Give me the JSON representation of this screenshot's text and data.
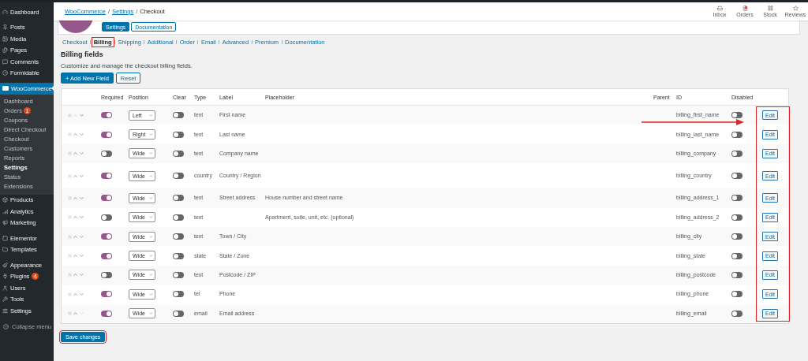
{
  "sidebar": {
    "sections": [
      [
        {
          "label": "Dashboard",
          "selected": false
        }
      ],
      [
        {
          "label": "Posts",
          "selected": false
        },
        {
          "label": "Media",
          "selected": false
        },
        {
          "label": "Pages",
          "selected": false
        },
        {
          "label": "Comments",
          "selected": false
        },
        {
          "label": "Formidable",
          "selected": false
        }
      ],
      [
        {
          "label": "WooCommerce",
          "selected": true,
          "children": [
            {
              "label": "Dashboard",
              "selected": false
            },
            {
              "label": "Orders",
              "badge": "1",
              "selected": false
            },
            {
              "label": "Coupons",
              "selected": false
            },
            {
              "label": "Direct Checkout",
              "selected": false
            },
            {
              "label": "Checkout",
              "selected": false
            },
            {
              "label": "Customers",
              "selected": false
            },
            {
              "label": "Reports",
              "selected": false
            },
            {
              "label": "Settings",
              "selected": true
            },
            {
              "label": "Status",
              "selected": false
            },
            {
              "label": "Extensions",
              "selected": false
            }
          ]
        },
        {
          "label": "Products",
          "selected": false
        },
        {
          "label": "Analytics",
          "selected": false
        },
        {
          "label": "Marketing",
          "selected": false
        }
      ],
      [
        {
          "label": "Elementor",
          "selected": false
        },
        {
          "label": "Templates",
          "selected": false
        }
      ],
      [
        {
          "label": "Appearance",
          "selected": false
        },
        {
          "label": "Plugins",
          "badge": "4",
          "selected": false
        },
        {
          "label": "Users",
          "selected": false
        },
        {
          "label": "Tools",
          "selected": false
        },
        {
          "label": "Settings",
          "selected": false
        }
      ]
    ],
    "collapse": "Collapse menu"
  },
  "breadcrumb": {
    "separator": "/",
    "items": [
      {
        "label": "WooCommerce",
        "link": true
      },
      {
        "label": "Settings",
        "link": true
      },
      {
        "label": "Checkout",
        "link": false
      }
    ]
  },
  "header_actions": [
    {
      "label": "Inbox",
      "notification": false
    },
    {
      "label": "Orders",
      "notification": true
    },
    {
      "label": "Stock",
      "notification": false
    },
    {
      "label": "Reviews",
      "notification": false
    }
  ],
  "plugin_card": {
    "buttons": [
      {
        "label": "Settings",
        "selected": true
      },
      {
        "label": "Documentation",
        "selected": false
      }
    ]
  },
  "tabs": [
    {
      "label": "Checkout",
      "selected": false,
      "annotated": false
    },
    {
      "label": "Billing",
      "selected": true,
      "annotated": true
    },
    {
      "label": "Shipping",
      "selected": false,
      "annotated": false
    },
    {
      "label": "Additional",
      "selected": false,
      "annotated": false
    },
    {
      "label": "Order",
      "selected": false,
      "annotated": false
    },
    {
      "label": "Email",
      "selected": false,
      "annotated": false
    },
    {
      "label": "Advanced",
      "selected": false,
      "annotated": false
    },
    {
      "label": "Premium",
      "selected": false,
      "annotated": false
    },
    {
      "label": "Documentation",
      "selected": false,
      "annotated": false
    }
  ],
  "heading": "Billing fields",
  "description": "Customize and manage the checkout billing fields.",
  "actions": [
    {
      "label": "+ Add New Field",
      "primary": true
    },
    {
      "label": "Reset",
      "primary": false
    }
  ],
  "table": {
    "columns": [
      "Required",
      "Position",
      "Clear",
      "Type",
      "Label",
      "Placeholder",
      "Parent",
      "ID",
      "Disabled"
    ],
    "edit_column_annotated": true,
    "annotation_arrow": true,
    "rows": [
      {
        "can_move_up": false,
        "can_move_down": true,
        "required": true,
        "position": "Left",
        "clear": false,
        "type": "text",
        "label": "First name",
        "id": "billing_first_name",
        "disabled": false,
        "action": "Edit"
      },
      {
        "can_move_up": true,
        "can_move_down": true,
        "required": true,
        "position": "Right",
        "clear": false,
        "type": "text",
        "label": "Last name",
        "id": "billing_last_name",
        "disabled": false,
        "action": "Edit"
      },
      {
        "can_move_up": true,
        "can_move_down": true,
        "required": false,
        "position": "Wide",
        "clear": false,
        "type": "text",
        "label": "Company name",
        "id": "billing_company",
        "disabled": false,
        "action": "Edit"
      },
      {
        "can_move_up": true,
        "can_move_down": true,
        "required": true,
        "position": "Wide",
        "clear": false,
        "type": "country",
        "label": "Country / Region",
        "id": "billing_country",
        "disabled": false,
        "action": "Edit"
      },
      {
        "can_move_up": true,
        "can_move_down": true,
        "required": true,
        "position": "Wide",
        "clear": false,
        "type": "text",
        "label": "Street address",
        "placeholder": "House number and street name",
        "id": "billing_address_1",
        "disabled": false,
        "action": "Edit"
      },
      {
        "can_move_up": true,
        "can_move_down": true,
        "required": false,
        "position": "Wide",
        "clear": false,
        "type": "text",
        "placeholder": "Apartment, suite, unit, etc. (optional)",
        "id": "billing_address_2",
        "disabled": false,
        "action": "Edit"
      },
      {
        "can_move_up": true,
        "can_move_down": true,
        "required": true,
        "position": "Wide",
        "clear": false,
        "type": "text",
        "label": "Town / City",
        "id": "billing_city",
        "disabled": false,
        "action": "Edit"
      },
      {
        "can_move_up": true,
        "can_move_down": true,
        "required": true,
        "position": "Wide",
        "clear": false,
        "type": "state",
        "label": "State / Zone",
        "id": "billing_state",
        "disabled": false,
        "action": "Edit"
      },
      {
        "can_move_up": true,
        "can_move_down": true,
        "required": false,
        "position": "Wide",
        "clear": false,
        "type": "text",
        "label": "Postcode / ZIP",
        "id": "billing_postcode",
        "disabled": false,
        "action": "Edit"
      },
      {
        "can_move_up": true,
        "can_move_down": true,
        "required": true,
        "position": "Wide",
        "clear": false,
        "type": "tel",
        "label": "Phone",
        "id": "billing_phone",
        "disabled": false,
        "action": "Edit"
      },
      {
        "can_move_up": true,
        "can_move_down": false,
        "required": true,
        "position": "Wide",
        "clear": false,
        "type": "email",
        "label": "Email address",
        "id": "billing_email",
        "disabled": false,
        "action": "Edit"
      }
    ]
  },
  "save": {
    "label": "Save changes",
    "annotated": true
  }
}
